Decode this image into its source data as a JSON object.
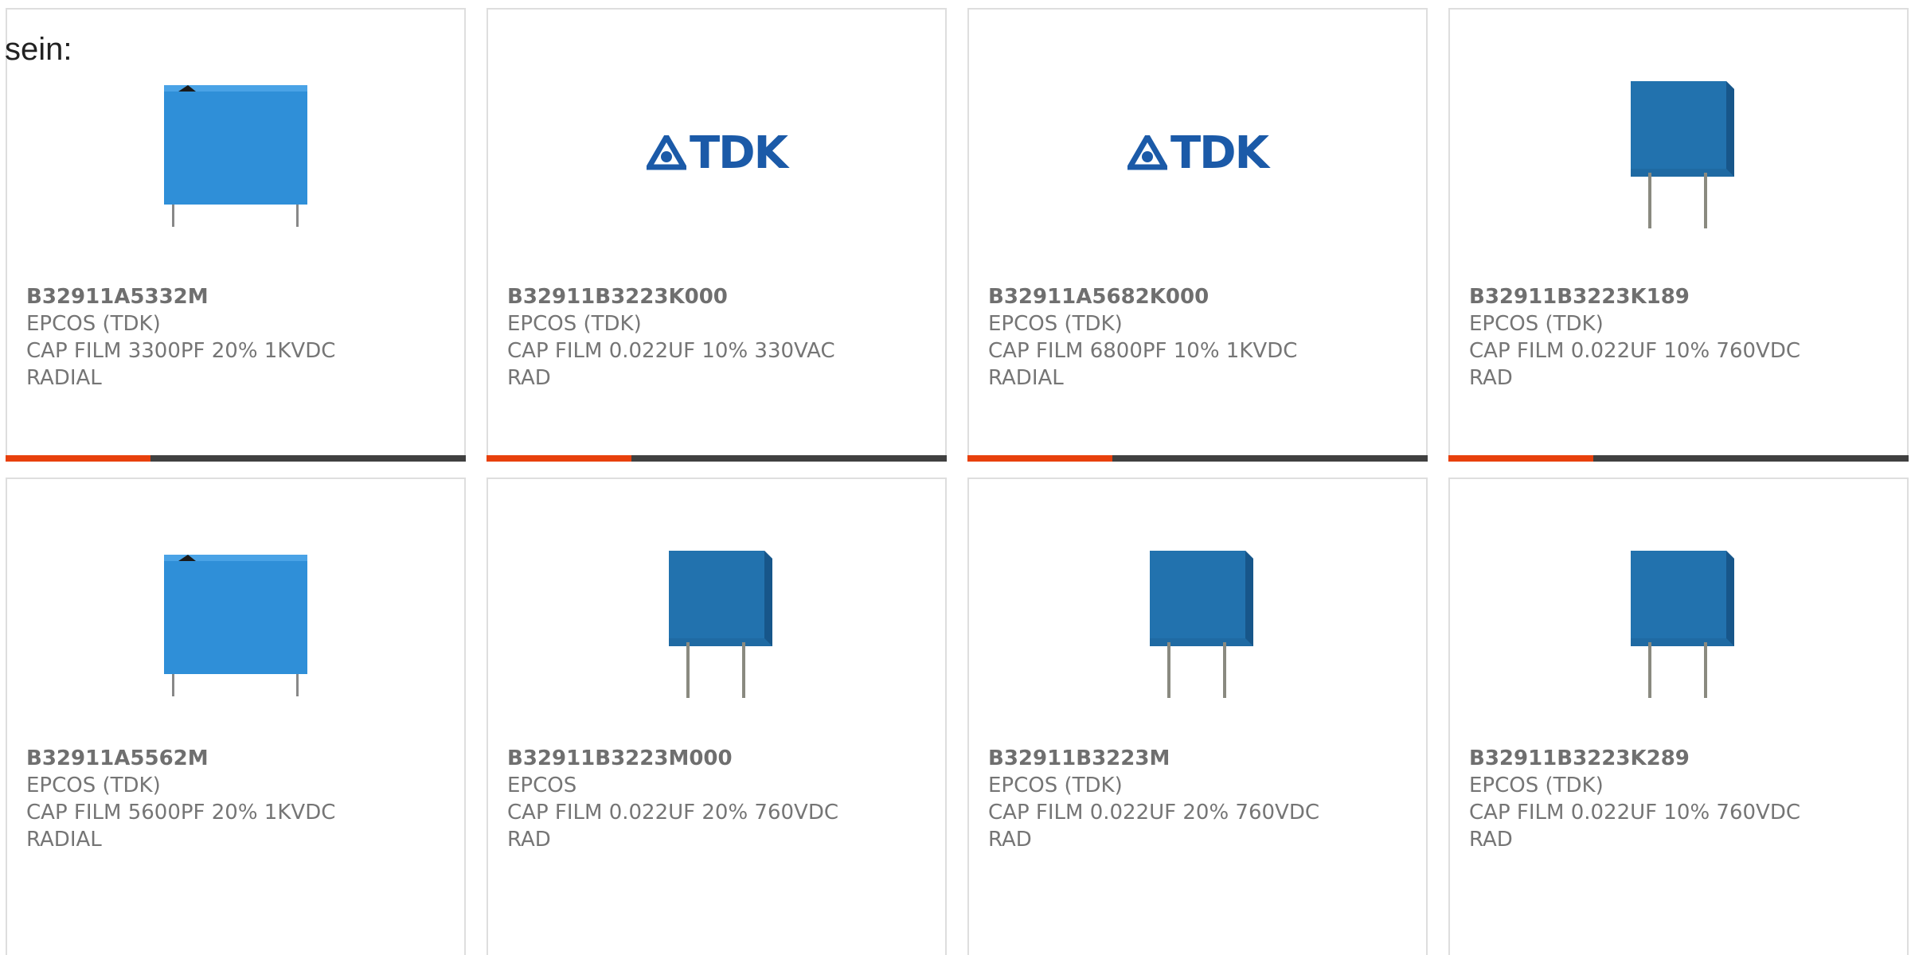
{
  "intro_text": "sein:",
  "colors": {
    "accent": "#e8400c",
    "bar_dark": "#404040",
    "text": "#757575",
    "capacitor_light": "#2f8fd8",
    "capacitor_dark": "#1f6aa3",
    "tdk_blue": "#1b5aa8"
  },
  "products": [
    {
      "part_number": "B32911A5332M",
      "manufacturer": "EPCOS (TDK)",
      "description": "CAP FILM 3300PF 20% 1KVDC",
      "package": "RADIAL",
      "image": "capacitor-box-light"
    },
    {
      "part_number": "B32911B3223K000",
      "manufacturer": "EPCOS (TDK)",
      "description": "CAP FILM 0.022UF 10% 330VAC",
      "package": "RAD",
      "image": "tdk-logo",
      "logo_text": "TDK"
    },
    {
      "part_number": "B32911A5682K000",
      "manufacturer": "EPCOS (TDK)",
      "description": "CAP FILM 6800PF 10% 1KVDC",
      "package": "RADIAL",
      "image": "tdk-logo",
      "logo_text": "TDK"
    },
    {
      "part_number": "B32911B3223K189",
      "manufacturer": "EPCOS (TDK)",
      "description": "CAP FILM 0.022UF 10% 760VDC",
      "package": "RAD",
      "image": "capacitor-box-dark"
    },
    {
      "part_number": "B32911A5562M",
      "manufacturer": "EPCOS (TDK)",
      "description": "CAP FILM 5600PF 20% 1KVDC",
      "package": "RADIAL",
      "image": "capacitor-box-light"
    },
    {
      "part_number": "B32911B3223M000",
      "manufacturer": "EPCOS",
      "description": "CAP FILM 0.022UF 20% 760VDC",
      "package": "RAD",
      "image": "capacitor-box-dark"
    },
    {
      "part_number": "B32911B3223M",
      "manufacturer": "EPCOS (TDK)",
      "description": "CAP FILM 0.022UF 20% 760VDC",
      "package": "RAD",
      "image": "capacitor-box-dark"
    },
    {
      "part_number": "B32911B3223K289",
      "manufacturer": "EPCOS (TDK)",
      "description": "CAP FILM 0.022UF 10% 760VDC",
      "package": "RAD",
      "image": "capacitor-box-dark"
    }
  ]
}
